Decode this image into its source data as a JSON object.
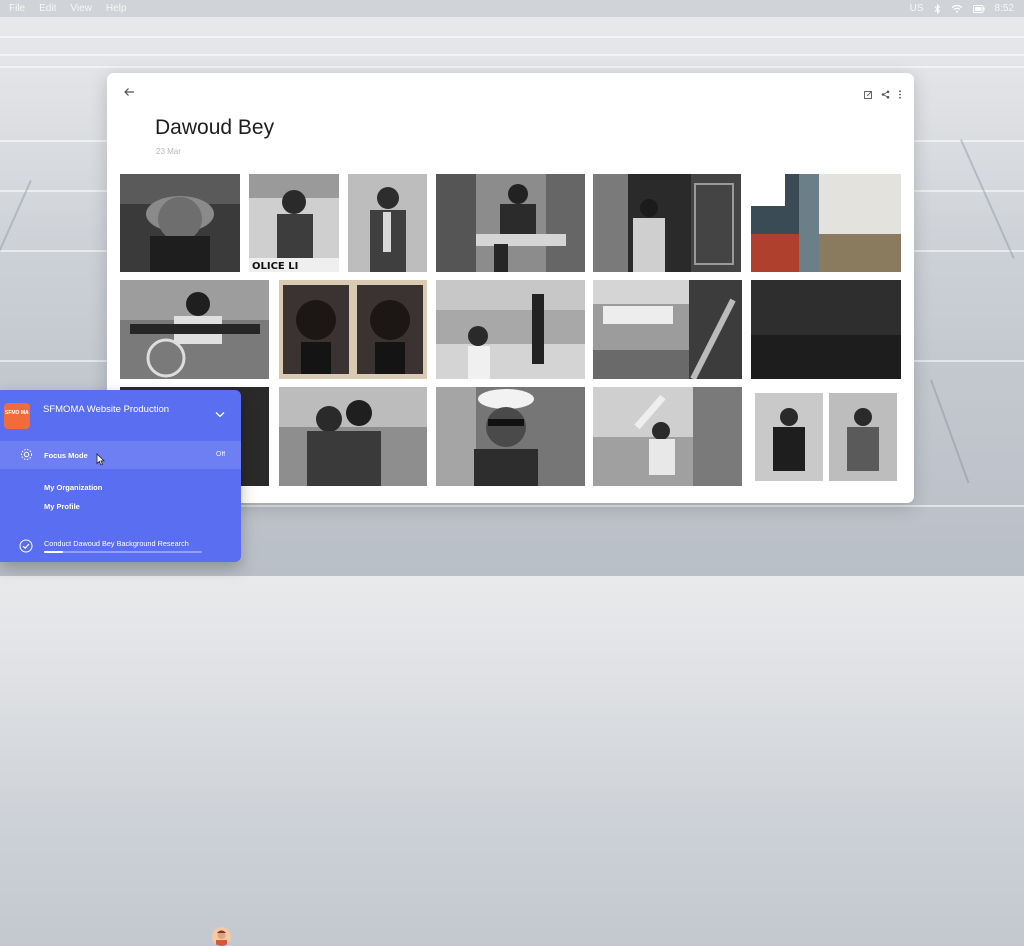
{
  "menubar": {
    "items": [
      "File",
      "Edit",
      "View",
      "Help"
    ],
    "input_source": "US",
    "clock": "8:52",
    "icons": [
      "bluetooth-icon",
      "wifi-icon",
      "battery-icon"
    ]
  },
  "album": {
    "title": "Dawoud Bey",
    "date": "23 Mar",
    "toolbar_icons": [
      "edit-icon",
      "share-icon",
      "more-icon"
    ],
    "photos": [
      "hat-woman",
      "police-line",
      "boy-standing",
      "boy-sunglasses",
      "woman-doorway",
      "chainlink-fence",
      "man-bicycle",
      "two-portraits",
      "boy-fence",
      "stairway-laundry",
      "dark-water",
      "dark-portrait",
      "two-young-women",
      "woman-sunglasses",
      "kids-window",
      "two-seated-men"
    ]
  },
  "panel": {
    "logo_text": "SFMO MA",
    "title": "SFMOMA Website Production",
    "focus_mode_label": "Focus Mode",
    "focus_mode_state": "Off",
    "links": [
      "My Organization",
      "My Profile"
    ],
    "task": "Conduct Dawoud Bey Background Research",
    "task_progress": 0.12,
    "accent": "#5a6ef2",
    "logo_color": "#f26b3a"
  }
}
